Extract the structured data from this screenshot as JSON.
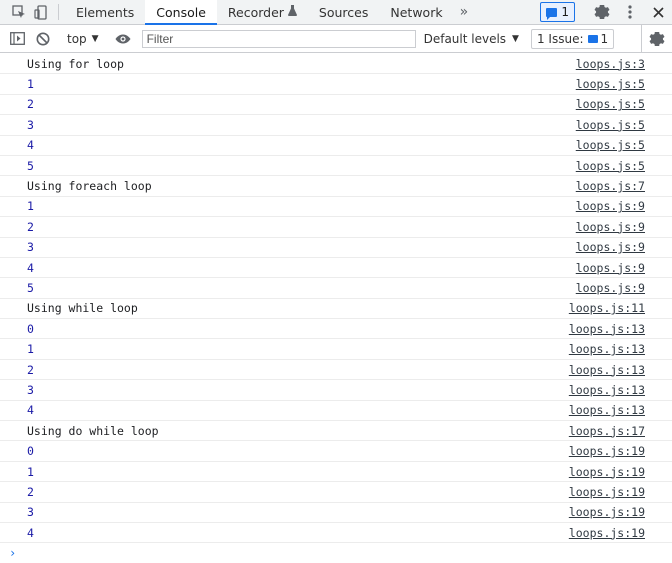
{
  "tabs": [
    {
      "label": "Elements",
      "active": false
    },
    {
      "label": "Console",
      "active": true
    },
    {
      "label": "Recorder",
      "active": false,
      "flask": true
    },
    {
      "label": "Sources",
      "active": false
    },
    {
      "label": "Network",
      "active": false
    }
  ],
  "tab_more": "»",
  "messages_badge": "1",
  "toolbar": {
    "context": "top",
    "filter_placeholder": "Filter",
    "levels": "Default levels",
    "issues": "1 Issue:",
    "issues_count": "1"
  },
  "icons": {
    "inspect": "inspect-icon",
    "device": "device-toggle-icon",
    "sidebar": "sidebar-toggle-icon",
    "clear": "clear-console-icon",
    "eye": "live-expression-icon",
    "gear": "gear-icon",
    "kebab": "more-options-icon",
    "close": "close-icon"
  },
  "colors": {
    "accent": "#1a73e8",
    "number": "#1a1aa6"
  },
  "console": [
    {
      "text": "Using for loop",
      "src": "loops.js:3",
      "num": false
    },
    {
      "text": "1",
      "src": "loops.js:5",
      "num": true
    },
    {
      "text": "2",
      "src": "loops.js:5",
      "num": true
    },
    {
      "text": "3",
      "src": "loops.js:5",
      "num": true
    },
    {
      "text": "4",
      "src": "loops.js:5",
      "num": true
    },
    {
      "text": "5",
      "src": "loops.js:5",
      "num": true
    },
    {
      "text": "Using foreach loop",
      "src": "loops.js:7",
      "num": false
    },
    {
      "text": "1",
      "src": "loops.js:9",
      "num": true
    },
    {
      "text": "2",
      "src": "loops.js:9",
      "num": true
    },
    {
      "text": "3",
      "src": "loops.js:9",
      "num": true
    },
    {
      "text": "4",
      "src": "loops.js:9",
      "num": true
    },
    {
      "text": "5",
      "src": "loops.js:9",
      "num": true
    },
    {
      "text": "Using while loop",
      "src": "loops.js:11",
      "num": false
    },
    {
      "text": "0",
      "src": "loops.js:13",
      "num": true
    },
    {
      "text": "1",
      "src": "loops.js:13",
      "num": true
    },
    {
      "text": "2",
      "src": "loops.js:13",
      "num": true
    },
    {
      "text": "3",
      "src": "loops.js:13",
      "num": true
    },
    {
      "text": "4",
      "src": "loops.js:13",
      "num": true
    },
    {
      "text": "Using do while loop",
      "src": "loops.js:17",
      "num": false
    },
    {
      "text": "0",
      "src": "loops.js:19",
      "num": true
    },
    {
      "text": "1",
      "src": "loops.js:19",
      "num": true
    },
    {
      "text": "2",
      "src": "loops.js:19",
      "num": true
    },
    {
      "text": "3",
      "src": "loops.js:19",
      "num": true
    },
    {
      "text": "4",
      "src": "loops.js:19",
      "num": true
    }
  ],
  "prompt": "›"
}
